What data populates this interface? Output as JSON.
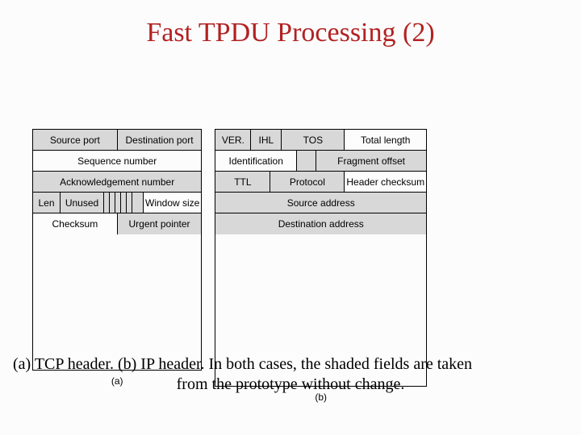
{
  "title": "Fast TPDU Processing (2)",
  "tcp": {
    "source_port": "Source port",
    "dest_port": "Destination  port",
    "seq": "Sequence number",
    "ack": "Acknowledgement number",
    "len": "Len",
    "unused": "Unused",
    "window": "Window size",
    "checksum": "Checksum",
    "urgent": "Urgent pointer",
    "label": "(a)"
  },
  "ip": {
    "ver": "VER.",
    "ihl": "IHL",
    "tos": "TOS",
    "total_len": "Total length",
    "ident": "Identification",
    "frag": "Fragment offset",
    "ttl": "TTL",
    "proto": "Protocol",
    "chk": "Header checksum",
    "src": "Source address",
    "dst": "Destination address",
    "label": "(b)"
  },
  "caption_line1": "(a) TCP header.  (b) IP header. In both cases, the shaded fields are taken",
  "caption_line2": "from the prototype without change."
}
